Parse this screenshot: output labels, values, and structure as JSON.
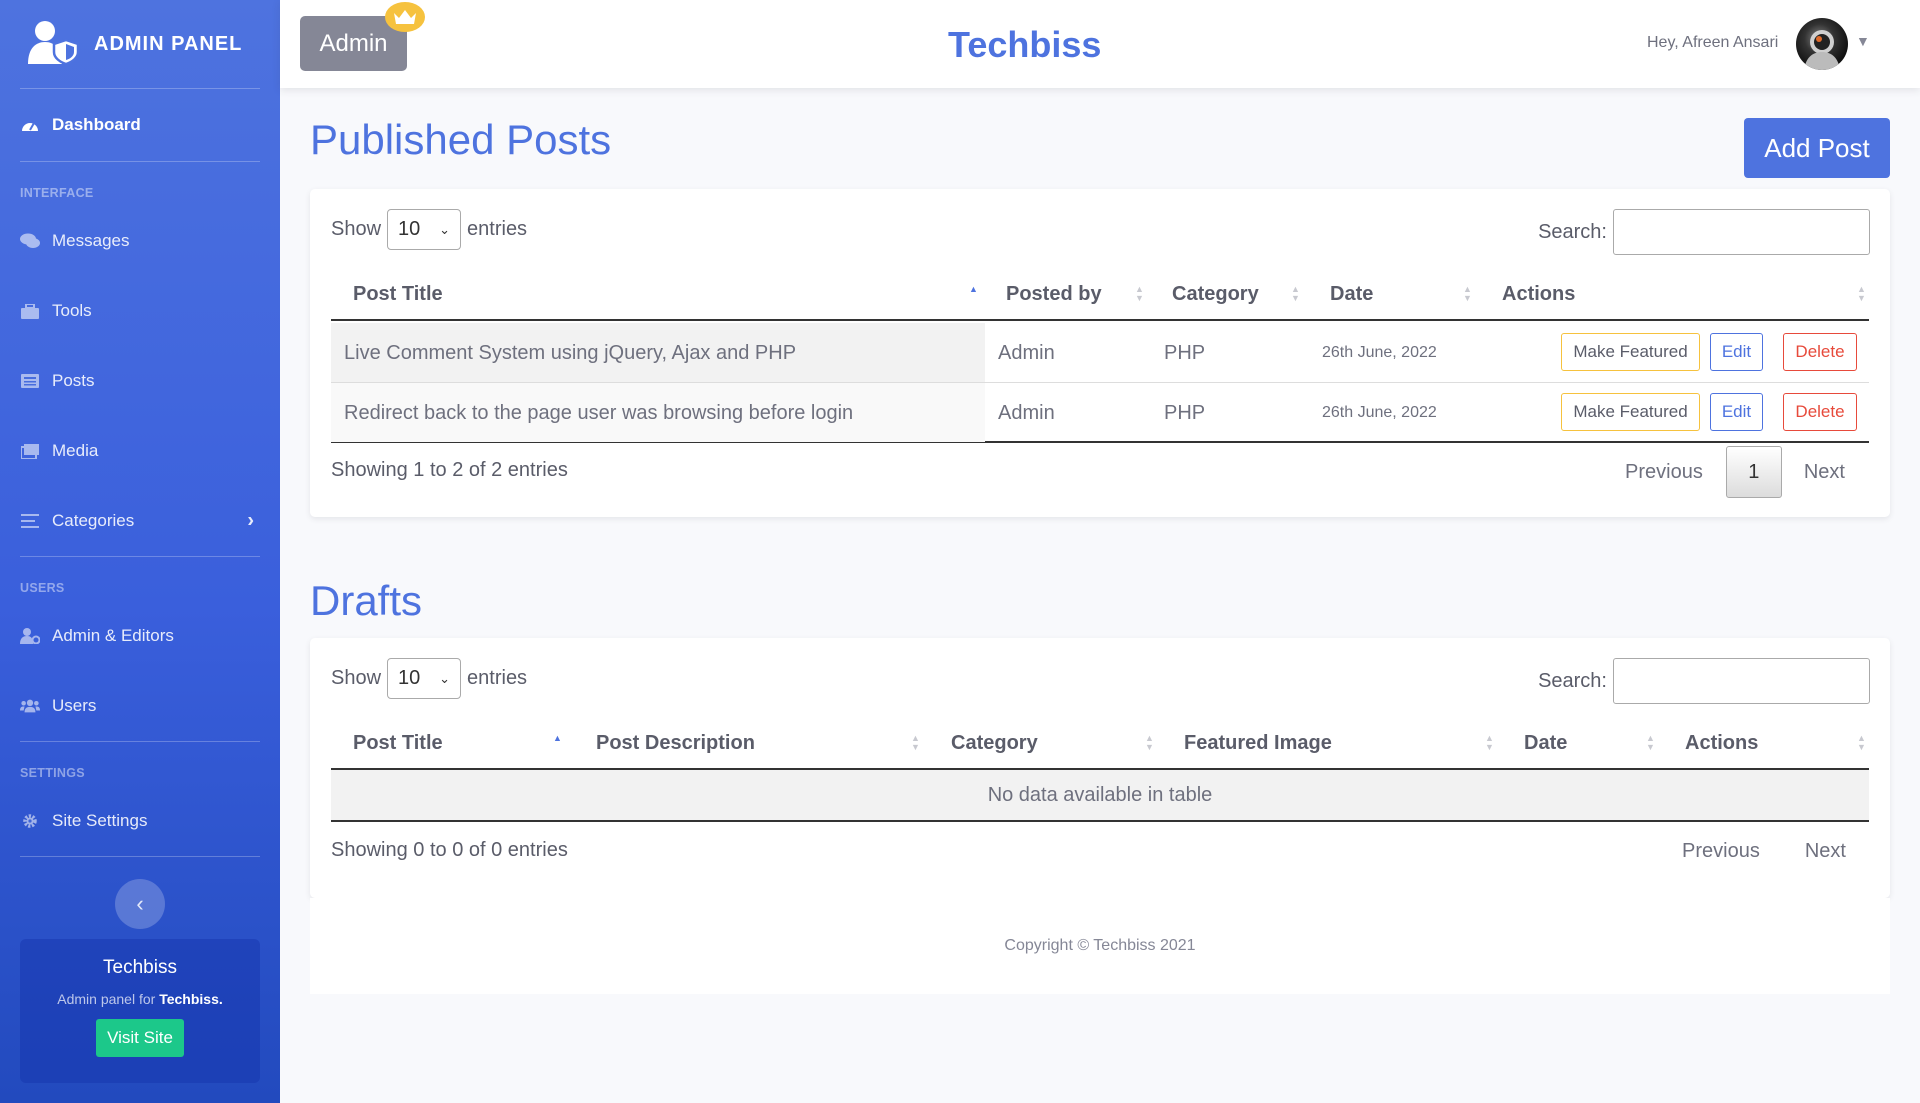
{
  "sidebar": {
    "brand": "ADMIN PANEL",
    "dashboard": "Dashboard",
    "heading_interface": "INTERFACE",
    "messages": "Messages",
    "tools": "Tools",
    "posts": "Posts",
    "media": "Media",
    "categories": "Categories",
    "heading_users": "USERS",
    "admin_editors": "Admin & Editors",
    "users": "Users",
    "heading_settings": "SETTINGS",
    "site_settings": "Site Settings",
    "toggle_icon": "‹",
    "card": {
      "title": "Techbiss",
      "desc_prefix": "Admin panel for",
      "desc_brand": "Techbiss.",
      "button": "Visit Site"
    }
  },
  "topbar": {
    "badge": "Admin",
    "site_title": "Techbiss",
    "greeting": "Hey, Afreen Ansari"
  },
  "published": {
    "heading": "Published Posts",
    "add_button": "Add Post",
    "show_label": "Show",
    "entries_select": "10",
    "entries_label": "entries",
    "search_label": "Search:",
    "columns": [
      "Post Title",
      "Posted by",
      "Category",
      "Date",
      "Actions"
    ],
    "rows": [
      {
        "title": "Live Comment System using jQuery, Ajax and PHP",
        "posted_by": "Admin",
        "category": "PHP",
        "date": "26th June, 2022"
      },
      {
        "title": "Redirect back to the page user was browsing before login",
        "posted_by": "Admin",
        "category": "PHP",
        "date": "26th June, 2022"
      }
    ],
    "actions": {
      "featured": "Make Featured",
      "edit": "Edit",
      "delete": "Delete"
    },
    "info": "Showing 1 to 2 of 2 entries",
    "pager": {
      "previous": "Previous",
      "current": "1",
      "next": "Next"
    }
  },
  "drafts": {
    "heading": "Drafts",
    "show_label": "Show",
    "entries_select": "10",
    "entries_label": "entries",
    "search_label": "Search:",
    "columns": [
      "Post Title",
      "Post Description",
      "Category",
      "Featured Image",
      "Date",
      "Actions"
    ],
    "empty": "No data available in table",
    "info": "Showing 0 to 0 of 0 entries",
    "pager": {
      "previous": "Previous",
      "next": "Next"
    }
  },
  "footer": {
    "copyright": "Copyright © Techbiss 2021"
  },
  "colors": {
    "primary": "#4e73df",
    "success": "#1cc88a",
    "warning": "#f6c23e",
    "danger": "#e74a3b",
    "secondary": "#858796"
  }
}
